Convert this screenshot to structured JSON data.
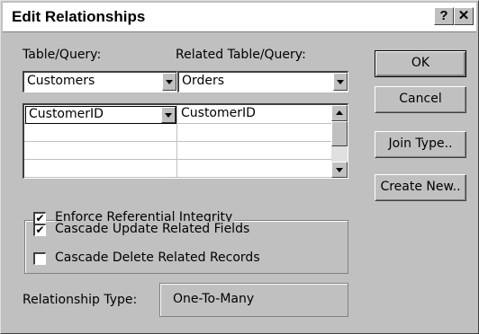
{
  "title": "Edit Relationships",
  "titlebar_buttons": {
    "help": "?",
    "close": "✕"
  },
  "table_label": "Table/Query:",
  "related_label": "Related Table/Query:",
  "table_value": "Customers",
  "related_value": "Orders",
  "fields": [
    {
      "left": "CustomerID",
      "right": "CustomerID"
    },
    {
      "left": "",
      "right": ""
    },
    {
      "left": "",
      "right": ""
    },
    {
      "left": "",
      "right": ""
    }
  ],
  "options": {
    "enforce": {
      "label": "Enforce Referential Integrity",
      "checked": true
    },
    "cascade_update": {
      "label": "Cascade Update Related Fields",
      "checked": true
    },
    "cascade_delete": {
      "label": "Cascade Delete Related Records",
      "checked": false
    }
  },
  "buttons": {
    "ok": "OK",
    "cancel": "Cancel",
    "join_type": "Join Type..",
    "create_new": "Create New.."
  },
  "relationship_type_label": "Relationship Type:",
  "relationship_type_value": "One-To-Many",
  "check_glyph": "✔"
}
